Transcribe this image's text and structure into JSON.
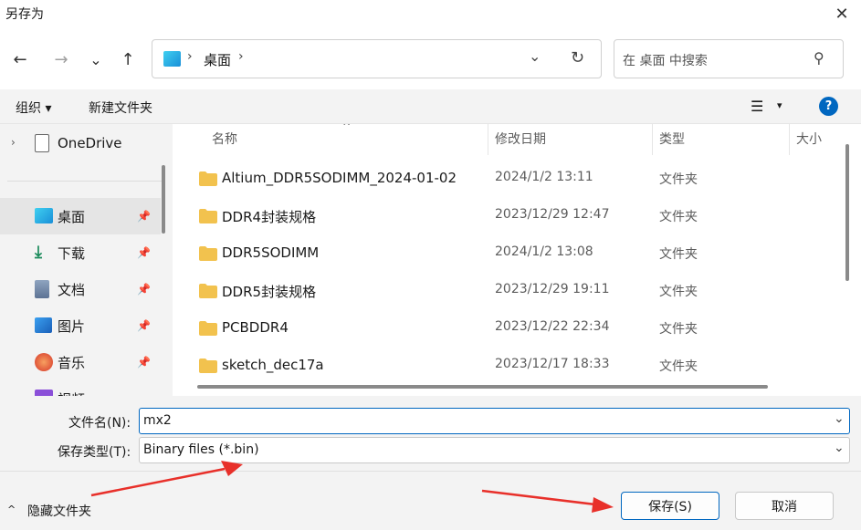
{
  "window": {
    "title": "另存为",
    "close_glyph": "✕"
  },
  "nav": {
    "back_glyph": "←",
    "forward_glyph": "→",
    "recent_glyph": "⌄",
    "up_glyph": "↑",
    "breadcrumb_sep": "›",
    "breadcrumb": "桌面",
    "dropdown_glyph": "⌄",
    "refresh_glyph": "↻",
    "search_placeholder": "在 桌面 中搜索",
    "search_glyph": "⚲"
  },
  "toolbar": {
    "organize": "组织 ▾",
    "new_folder": "新建文件夹",
    "view_glyph": "☰",
    "view_caret": "▾",
    "help_glyph": "?"
  },
  "sidebar": {
    "onedrive": "OneDrive",
    "items": [
      {
        "label": "桌面",
        "icon": "desktop-icon",
        "pin": "📌"
      },
      {
        "label": "下载",
        "icon": "download-icon",
        "pin": "📌"
      },
      {
        "label": "文档",
        "icon": "document-icon",
        "pin": "📌"
      },
      {
        "label": "图片",
        "icon": "picture-icon",
        "pin": "📌"
      },
      {
        "label": "音乐",
        "icon": "music-icon",
        "pin": "📌"
      },
      {
        "label": "视频",
        "icon": "video-icon",
        "pin": ""
      }
    ]
  },
  "columns": {
    "name": "名称",
    "modified": "修改日期",
    "type": "类型",
    "size": "大小",
    "sort_glyph": "^"
  },
  "files": [
    {
      "name": "Altium_DDR5SODIMM_2024-01-02",
      "date": "2024/1/2 13:11",
      "type": "文件夹"
    },
    {
      "name": "DDR4封装规格",
      "date": "2023/12/29 12:47",
      "type": "文件夹"
    },
    {
      "name": "DDR5SODIMM",
      "date": "2024/1/2 13:08",
      "type": "文件夹"
    },
    {
      "name": "DDR5封装规格",
      "date": "2023/12/29 19:11",
      "type": "文件夹"
    },
    {
      "name": "PCBDDR4",
      "date": "2023/12/22 22:34",
      "type": "文件夹"
    },
    {
      "name": "sketch_dec17a",
      "date": "2023/12/17 18:33",
      "type": "文件夹"
    }
  ],
  "form": {
    "filename_label": "文件名(N):",
    "filename_value": "mx2",
    "filetype_label": "保存类型(T):",
    "filetype_value": "Binary files (*.bin)",
    "caret": "⌄"
  },
  "footer": {
    "hide_folders": "隐藏文件夹",
    "hide_glyph": "^",
    "save": "保存(S)",
    "cancel": "取消"
  },
  "colors": {
    "accent": "#0067c0",
    "folder": "#f2c24e",
    "annotation_arrow": "#e8302a"
  }
}
